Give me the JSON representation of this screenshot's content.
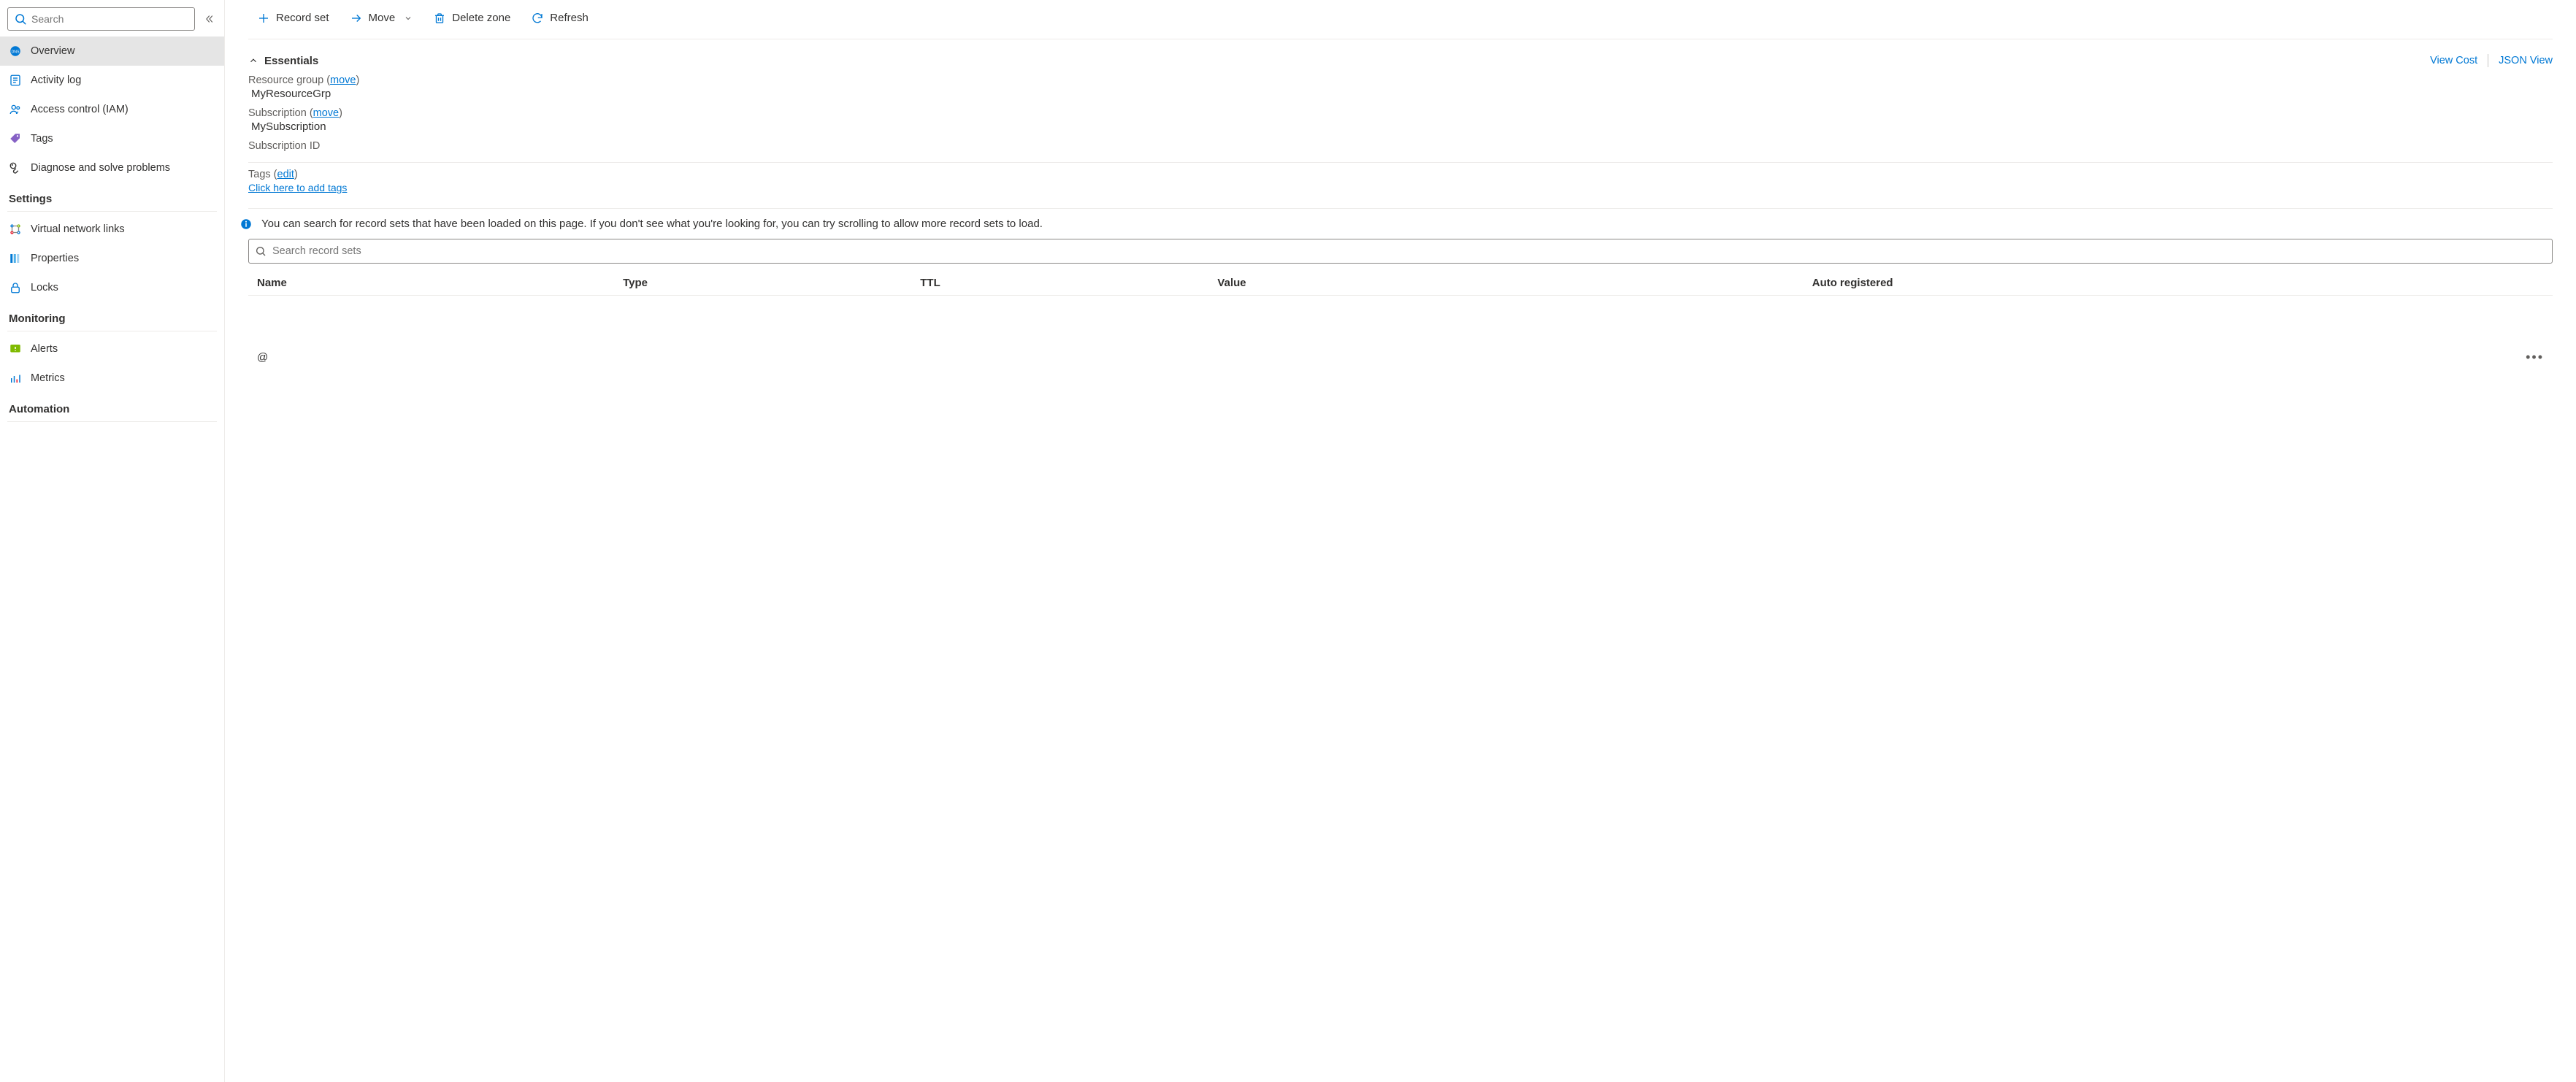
{
  "sidebar": {
    "search_placeholder": "Search",
    "items": [
      {
        "label": "Overview"
      },
      {
        "label": "Activity log"
      },
      {
        "label": "Access control (IAM)"
      },
      {
        "label": "Tags"
      },
      {
        "label": "Diagnose and solve problems"
      }
    ],
    "sections": {
      "settings": {
        "heading": "Settings",
        "items": [
          {
            "label": "Virtual network links"
          },
          {
            "label": "Properties"
          },
          {
            "label": "Locks"
          }
        ]
      },
      "monitoring": {
        "heading": "Monitoring",
        "items": [
          {
            "label": "Alerts"
          },
          {
            "label": "Metrics"
          }
        ]
      },
      "automation": {
        "heading": "Automation"
      }
    }
  },
  "cmdbar": {
    "record_set": "Record set",
    "move": "Move",
    "delete_zone": "Delete zone",
    "refresh": "Refresh"
  },
  "essentials": {
    "heading": "Essentials",
    "view_cost": "View Cost",
    "json_view": "JSON View",
    "resource_group_label": "Resource group",
    "resource_group_move": "move",
    "resource_group_value": "MyResourceGrp",
    "subscription_label": "Subscription",
    "subscription_move": "move",
    "subscription_value": "MySubscription",
    "subscription_id_label": "Subscription ID",
    "tags_label": "Tags",
    "tags_edit": "edit",
    "tags_add": "Click here to add tags"
  },
  "records": {
    "info": "You can search for record sets that have been loaded on this page. If you don't see what you're looking for, you can try scrolling to allow more record sets to load.",
    "search_placeholder": "Search record sets",
    "columns": {
      "name": "Name",
      "type": "Type",
      "ttl": "TTL",
      "value": "Value",
      "auto": "Auto registered"
    },
    "rows": [
      {
        "name": "@",
        "type": "",
        "ttl": "",
        "value": "",
        "auto": ""
      }
    ]
  }
}
